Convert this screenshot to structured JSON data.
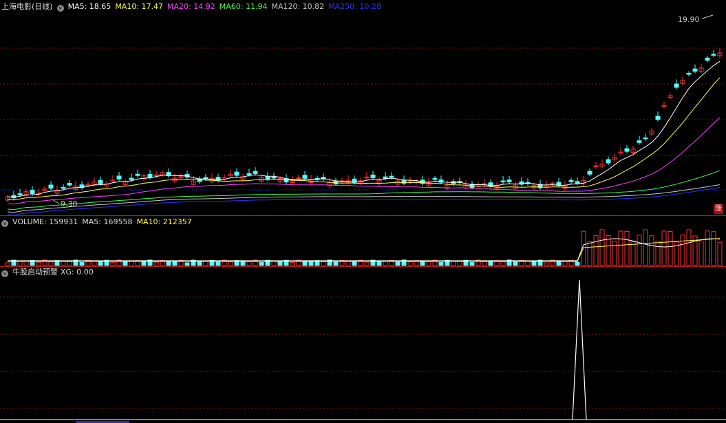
{
  "main": {
    "title": "上海电影(日线)",
    "ma": [
      {
        "label": "MA5: 18.65",
        "color": "#ffffff"
      },
      {
        "label": "MA10: 17.47",
        "color": "#ffff40"
      },
      {
        "label": "MA20: 14.92",
        "color": "#ff40ff"
      },
      {
        "label": "MA60: 11.94",
        "color": "#40ff40"
      },
      {
        "label": "MA120: 10.82",
        "color": "#c8c8c8"
      },
      {
        "label": "MA250: 10.28",
        "color": "#3030ff"
      }
    ],
    "high_label": "19.90",
    "low_label": "9.30",
    "badge": "涨"
  },
  "volume": {
    "items": [
      {
        "label": "VOLUME: 159931",
        "color": "#dddddd"
      },
      {
        "label": "MA5: 169558",
        "color": "#dddddd"
      },
      {
        "label": "MA10: 212357",
        "color": "#ffff40"
      }
    ]
  },
  "indicator": {
    "title": "牛股启动预警",
    "xg_label": "XG: 0.00"
  },
  "colors": {
    "up": "#ff3232",
    "down": "#54ffff",
    "grid": "#8b1010",
    "divider": "#b0181a"
  }
}
